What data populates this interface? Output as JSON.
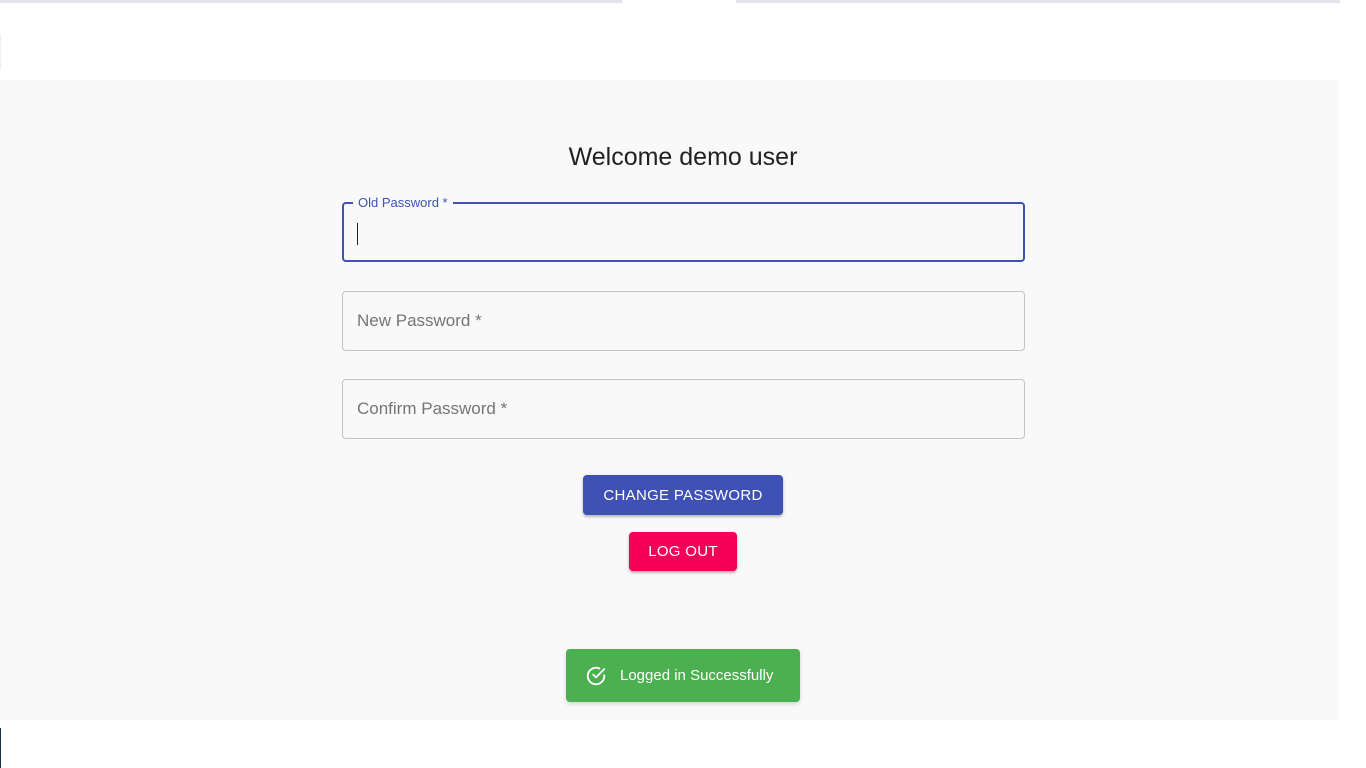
{
  "page": {
    "title": "Welcome demo user"
  },
  "form": {
    "old_password": {
      "label": "Old Password *",
      "value": ""
    },
    "new_password": {
      "placeholder": "New Password *",
      "value": ""
    },
    "confirm_password": {
      "placeholder": "Confirm Password *",
      "value": ""
    }
  },
  "actions": {
    "change_password_label": "CHANGE PASSWORD",
    "logout_label": "LOG OUT"
  },
  "toast": {
    "message": "Logged in Successfully",
    "icon": "check-circle-icon"
  },
  "colors": {
    "primary": "#3f51b5",
    "secondary": "#f50057",
    "success": "#4caf50",
    "background": "#f9f9f9"
  }
}
